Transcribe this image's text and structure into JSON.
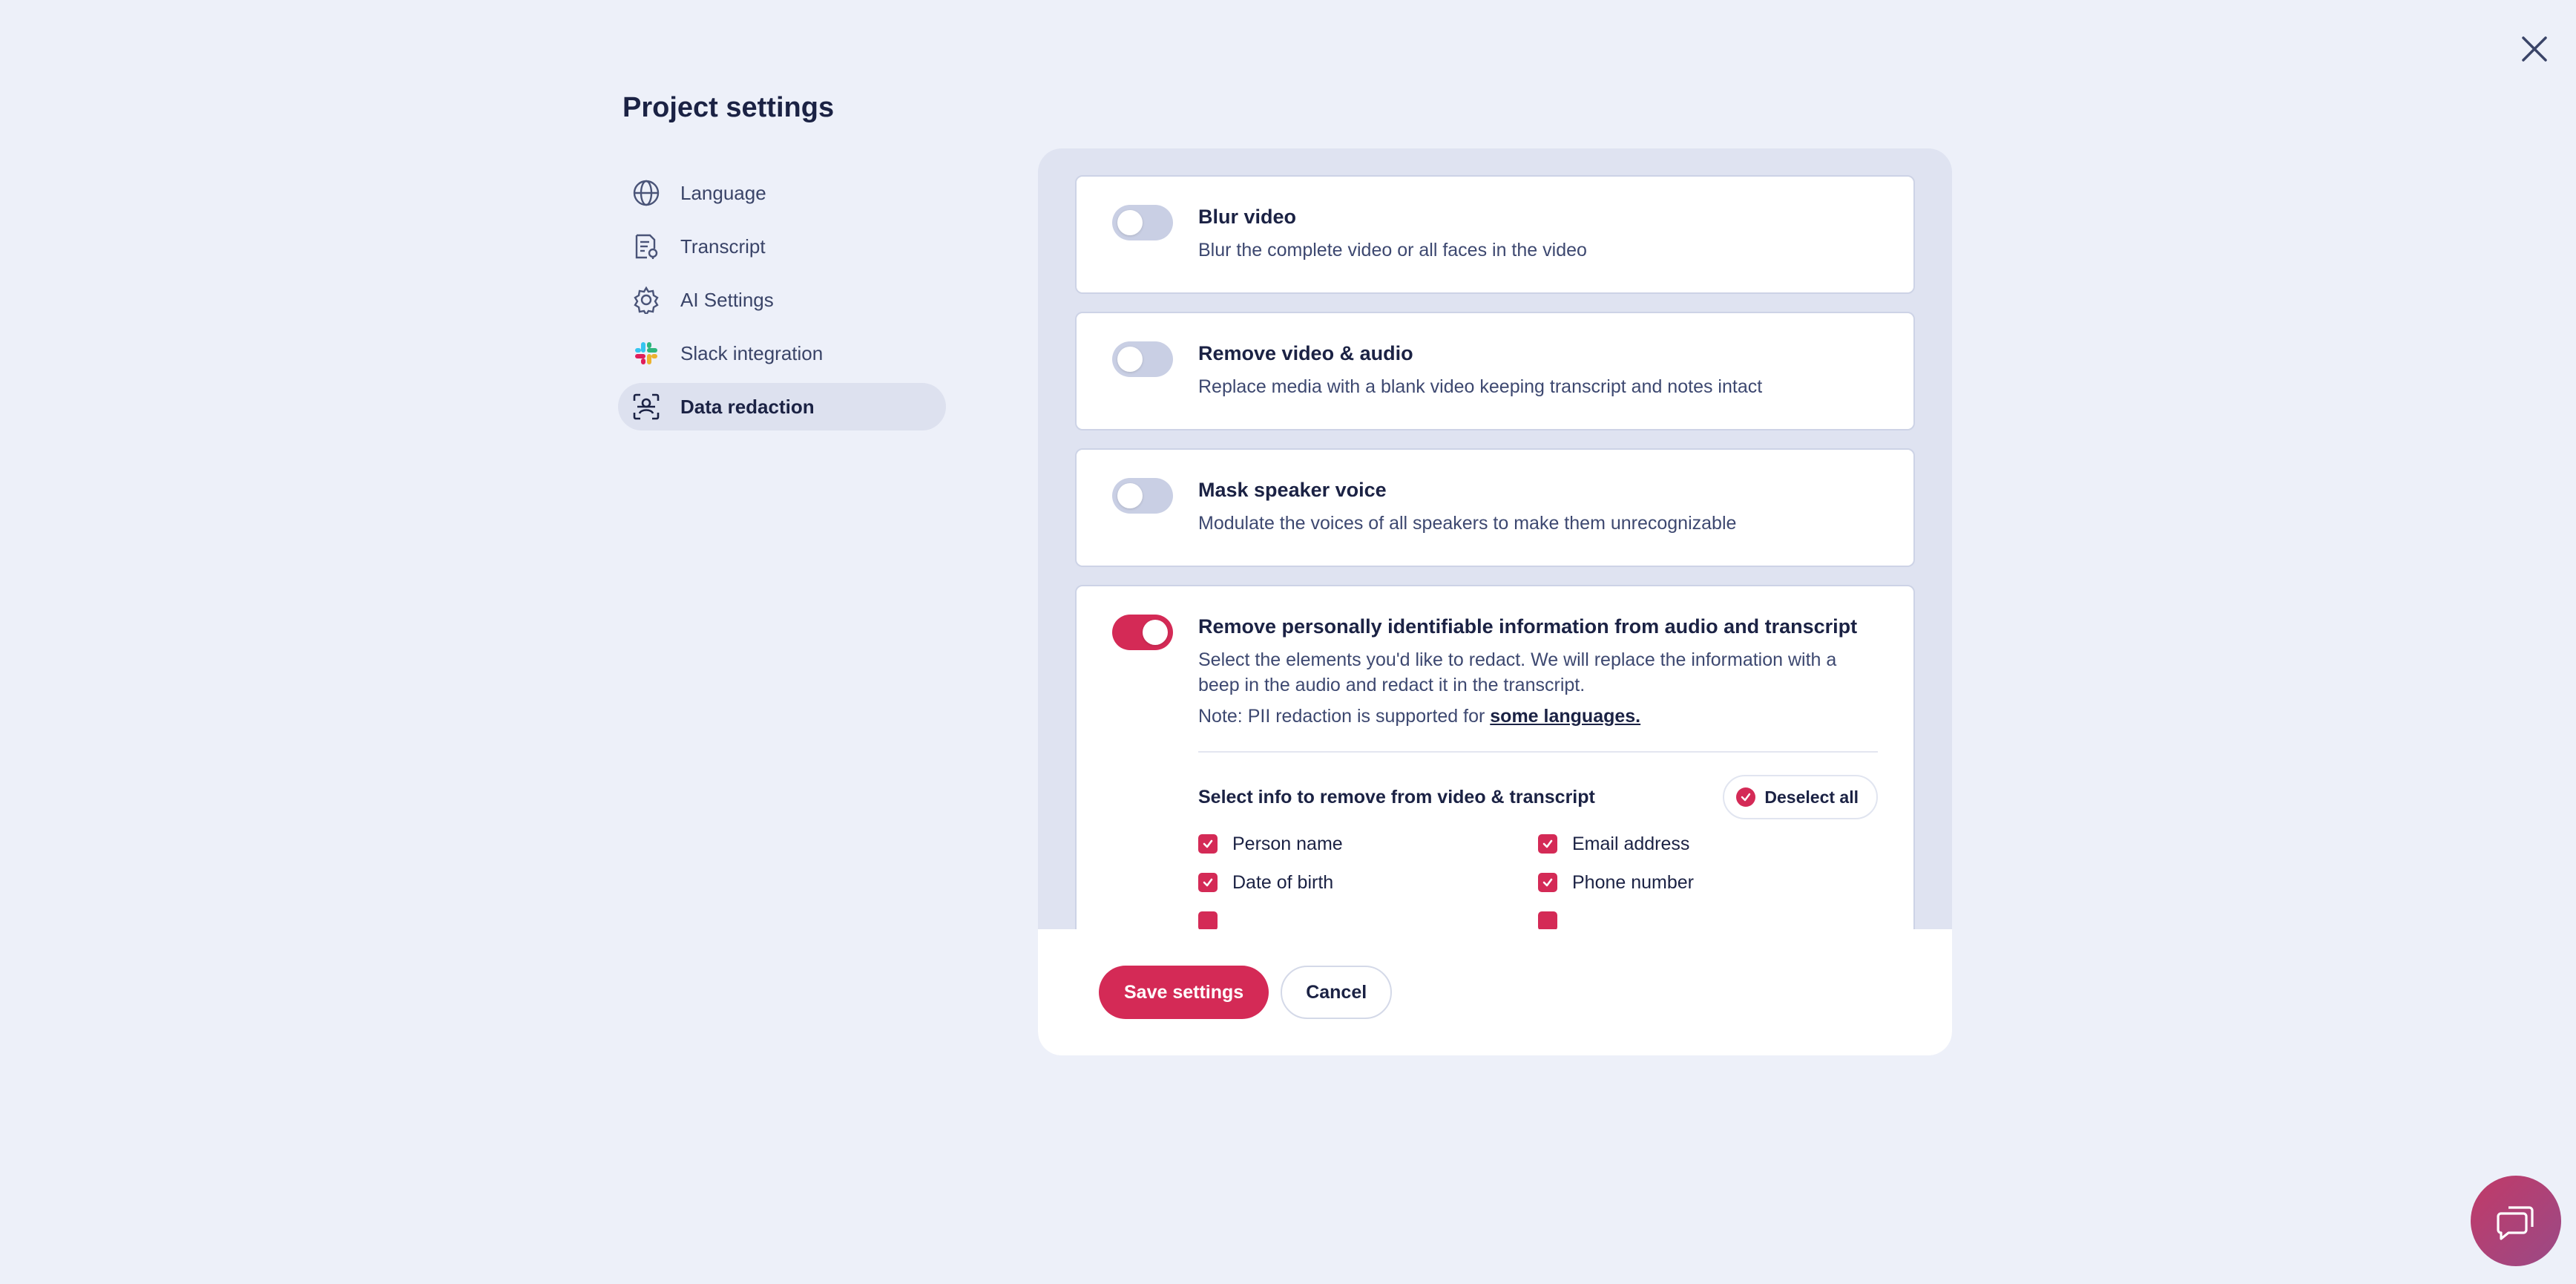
{
  "page": {
    "title": "Project settings"
  },
  "sidebar": {
    "items": [
      {
        "label": "Language",
        "icon": "globe-icon"
      },
      {
        "label": "Transcript",
        "icon": "transcript-icon"
      },
      {
        "label": "AI Settings",
        "icon": "gear-icon"
      },
      {
        "label": "Slack integration",
        "icon": "slack-icon"
      },
      {
        "label": "Data redaction",
        "icon": "face-scan-icon",
        "active": true
      }
    ]
  },
  "cards": {
    "blur": {
      "title": "Blur video",
      "desc": "Blur the complete video or all faces in the video",
      "enabled": false
    },
    "remove_media": {
      "title": "Remove video & audio",
      "desc": "Replace media with a blank video keeping transcript and notes intact",
      "enabled": false
    },
    "mask_voice": {
      "title": "Mask speaker voice",
      "desc": "Modulate the voices of all speakers to make them unrecognizable",
      "enabled": false
    },
    "pii": {
      "title": "Remove personally identifiable information from audio and transcript",
      "desc": "Select the elements you'd like to redact. We will replace the information with a beep in the audio and redact it in the transcript.",
      "note_prefix": "Note: PII redaction is supported for",
      "note_link": "some languages.",
      "enabled": true,
      "select_title": "Select info to remove from video & transcript",
      "deselect_label": "Deselect all",
      "options": [
        {
          "label": "Person name",
          "checked": true
        },
        {
          "label": "Email address",
          "checked": true
        },
        {
          "label": "Date of birth",
          "checked": true
        },
        {
          "label": "Phone number",
          "checked": true
        }
      ]
    }
  },
  "footer": {
    "save_label": "Save settings",
    "cancel_label": "Cancel"
  },
  "colors": {
    "accent": "#d42a56",
    "background": "#edf0f9",
    "panel": "#dfe3f1"
  }
}
